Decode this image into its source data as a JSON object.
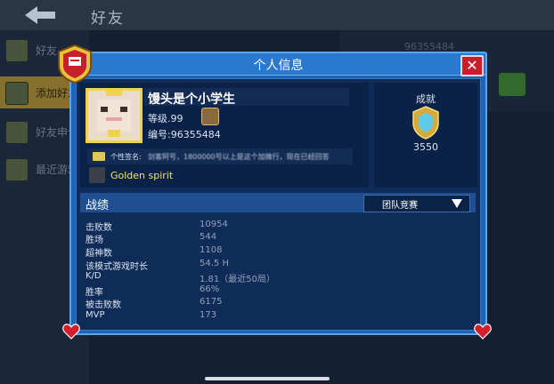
{
  "page": {
    "title": "好友"
  },
  "sidebar": {
    "items": [
      {
        "label": "好友",
        "active": false
      },
      {
        "label": "添加好友",
        "active": true
      },
      {
        "label": "好友申请",
        "active": false
      },
      {
        "label": "最近游戏",
        "active": false
      }
    ]
  },
  "background": {
    "search_id": "96355484"
  },
  "dialog": {
    "title": "个人信息",
    "close_icon": "close-x",
    "profile": {
      "name": "馒头是个小学生",
      "level": "等级.99",
      "code": "编号:96355484",
      "signature_label": "个性签名:",
      "signature": "剑客阿号，1800000号以上是这个加微行，现在已经回答",
      "title": "Golden spirit"
    },
    "achievement": {
      "label": "成就",
      "value": "3550"
    },
    "stats": {
      "title": "战绩",
      "mode": "团队竞赛",
      "rows": [
        {
          "label": "击败数",
          "value": "10954"
        },
        {
          "label": "胜场",
          "value": "544"
        },
        {
          "label": "超神数",
          "value": "1108"
        },
        {
          "label": "该模式游戏时长",
          "value": "54.5 H"
        },
        {
          "label": "K/D",
          "value": "1.81（最近50局）"
        },
        {
          "label": "胜率",
          "value": "66%"
        },
        {
          "label": "被击败数",
          "value": "6175"
        },
        {
          "label": "MVP",
          "value": "173"
        }
      ]
    }
  },
  "colors": {
    "dialog_blue": "#1d63b6",
    "close_red": "#c8202b",
    "accent_yellow": "#f4e35a"
  }
}
